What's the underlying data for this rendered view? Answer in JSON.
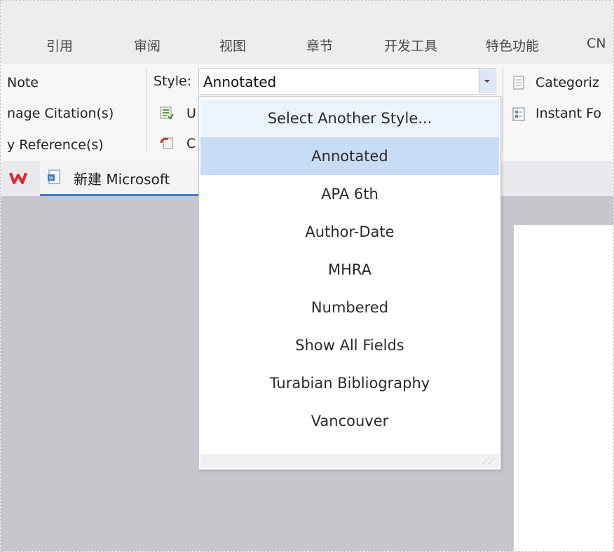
{
  "tabs": [
    "引用",
    "审阅",
    "视图",
    "章节",
    "开发工具",
    "特色功能",
    "CN"
  ],
  "ribbon": {
    "left_items": [
      "Note",
      "nage Citation(s)",
      "y Reference(s)"
    ],
    "style_label": "Style:",
    "style_value": "Annotated",
    "middle_items": [
      "U",
      "C"
    ],
    "right_items": [
      "Categoriz",
      "Instant Fo"
    ]
  },
  "doc_tab": {
    "title": "新建 Microsoft"
  },
  "style_dropdown": {
    "header": "Select Another Style...",
    "options": [
      "Annotated",
      "APA 6th",
      "Author-Date",
      "MHRA",
      "Numbered",
      "Show All Fields",
      "Turabian Bibliography",
      "Vancouver"
    ],
    "selected": "Annotated"
  },
  "colors": {
    "tabbar_bg": "#ededef",
    "ribbon_bg": "#f7f7f8",
    "selected_item_bg": "#c9dcf5",
    "header_item_bg": "#edf3fc",
    "doc_tab_accent": "#3c7fd4",
    "workspace_bg": "#c6c7cd",
    "wps_logo": "#e0262d"
  },
  "icons": [
    "wps-logo-icon",
    "document-icon",
    "update-citations-icon",
    "convert-icon",
    "categorize-icon",
    "instant-format-icon",
    "dropdown-arrow-icon",
    "resize-grip-icon"
  ]
}
